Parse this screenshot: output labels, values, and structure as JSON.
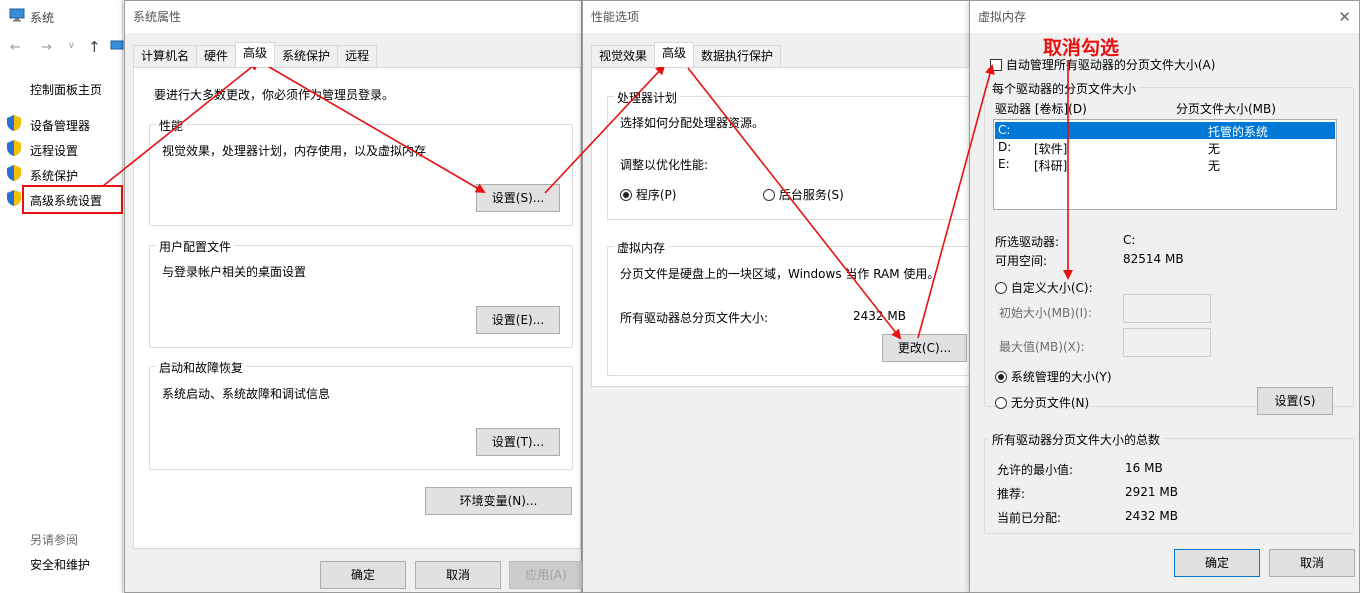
{
  "system": {
    "title": "系统",
    "links": {
      "home": "控制面板主页",
      "device_manager": "设备管理器",
      "remote": "远程设置",
      "protection": "系统保护",
      "advanced": "高级系统设置"
    },
    "see_also": "另请参阅",
    "security": "安全和维护"
  },
  "sysprops": {
    "title": "系统属性",
    "tabs": [
      "计算机名",
      "硬件",
      "高级",
      "系统保护",
      "远程"
    ],
    "admin_note": "要进行大多数更改，你必须作为管理员登录。",
    "perf": {
      "label": "性能",
      "desc": "视觉效果，处理器计划，内存使用，以及虚拟内存",
      "btn": "设置(S)..."
    },
    "profile": {
      "label": "用户配置文件",
      "desc": "与登录帐户相关的桌面设置",
      "btn": "设置(E)..."
    },
    "startup": {
      "label": "启动和故障恢复",
      "desc": "系统启动、系统故障和调试信息",
      "btn": "设置(T)..."
    },
    "env_btn": "环境变量(N)...",
    "ok": "确定",
    "cancel": "取消",
    "apply": "应用(A)"
  },
  "perfopts": {
    "title": "性能选项",
    "tabs": [
      "视觉效果",
      "高级",
      "数据执行保护"
    ],
    "sched": {
      "label": "处理器计划",
      "desc": "选择如何分配处理器资源。",
      "adjust": "调整以优化性能:",
      "opt1": "程序(P)",
      "opt2": "后台服务(S)"
    },
    "vm": {
      "label": "虚拟内存",
      "desc": "分页文件是硬盘上的一块区域，Windows 当作 RAM 使用。",
      "total_label": "所有驱动器总分页文件大小:",
      "total_value": "2432 MB",
      "btn": "更改(C)..."
    }
  },
  "vmem": {
    "title": "虚拟内存",
    "annotation": "取消勾选",
    "auto": "自动管理所有驱动器的分页文件大小(A)",
    "per_drive": "每个驱动器的分页文件大小",
    "col_drive": "驱动器 [卷标](D)",
    "col_size": "分页文件大小(MB)",
    "drives": [
      {
        "drive": "C:",
        "label": "",
        "size": "托管的系统"
      },
      {
        "drive": "D:",
        "label": "[软件]",
        "size": "无"
      },
      {
        "drive": "E:",
        "label": "[科研]",
        "size": "无"
      }
    ],
    "sel_label": "所选驱动器:",
    "sel_value": "C:",
    "avail_label": "可用空间:",
    "avail_value": "82514 MB",
    "custom": "自定义大小(C):",
    "initial": "初始大小(MB)(I):",
    "max": "最大值(MB)(X):",
    "managed": "系统管理的大小(Y)",
    "nopage": "无分页文件(N)",
    "set_btn": "设置(S)",
    "total_label": "所有驱动器分页文件大小的总数",
    "min_label": "允许的最小值:",
    "min_value": "16 MB",
    "rec_label": "推荐:",
    "rec_value": "2921 MB",
    "cur_label": "当前已分配:",
    "cur_value": "2432 MB",
    "ok": "确定",
    "cancel": "取消"
  },
  "colors": {
    "highlight": "#0078d7",
    "annotation": "#e81010"
  }
}
